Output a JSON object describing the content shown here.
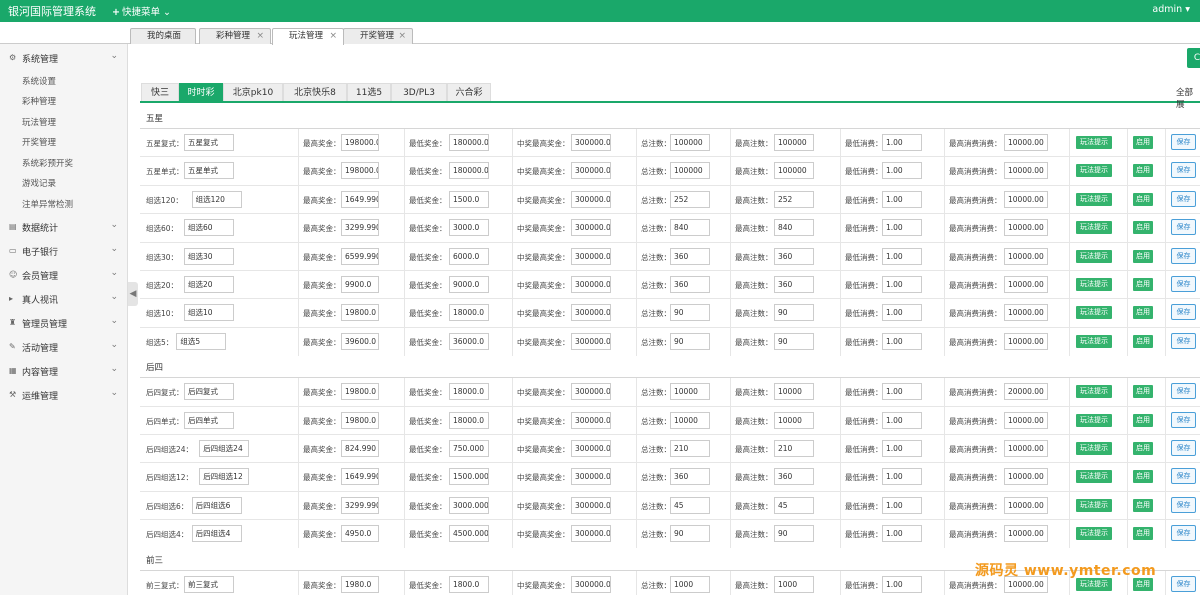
{
  "header": {
    "brand": "银河国际管理系统",
    "quick_menu": "快捷菜单",
    "user": "admin"
  },
  "tabs": [
    {
      "label": "我的桌面"
    },
    {
      "label": "彩种管理"
    },
    {
      "label": "玩法管理"
    },
    {
      "label": "开奖管理"
    }
  ],
  "sidebar": {
    "groups": [
      {
        "label": "系统管理",
        "icon": "gear-icon"
      },
      {
        "label": "数据统计",
        "icon": "chart-icon"
      },
      {
        "label": "电子银行",
        "icon": "bank-icon"
      },
      {
        "label": "会员管理",
        "icon": "user-icon"
      },
      {
        "label": "真人视讯",
        "icon": "video-icon"
      },
      {
        "label": "管理员管理",
        "icon": "admin-icon"
      },
      {
        "label": "活动管理",
        "icon": "event-icon"
      },
      {
        "label": "内容管理",
        "icon": "content-icon"
      },
      {
        "label": "运维管理",
        "icon": "ops-icon"
      }
    ],
    "sub_items": [
      "系统设置",
      "彩种管理",
      "玩法管理",
      "开奖管理",
      "系统彩预开奖",
      "游戏记录",
      "注单异常检测"
    ]
  },
  "lottery_tabs": [
    "快三",
    "时时彩",
    "北京pk10",
    "北京快乐8",
    "11选5",
    "3D/PL3",
    "六合彩"
  ],
  "all_label": "全部展",
  "field_labels": {
    "max_prize": "最高奖金：",
    "min_prize": "最低奖金：",
    "mid_prize": "中奖最高奖金：",
    "total_bets": "总注数：",
    "max_bets": "最高注数：",
    "min_spend": "最低消费：",
    "max_spend": "最高消费消费：",
    "tips_btn": "玩法提示",
    "enable_btn": "启用",
    "save_btn": "保存"
  },
  "sections": [
    {
      "title": "五星",
      "rows": [
        {
          "label": "五星复式：",
          "name": "五星复式",
          "max_prize": "198000.0",
          "min_prize": "180000.0",
          "mid_prize": "300000.0",
          "total": "100000",
          "max_bets": "100000",
          "min_spend": "1.00",
          "max_spend": "10000.00"
        },
        {
          "label": "五星单式：",
          "name": "五星单式",
          "max_prize": "198000.0",
          "min_prize": "180000.0",
          "mid_prize": "300000.0",
          "total": "100000",
          "max_bets": "100000",
          "min_spend": "1.00",
          "max_spend": "10000.00"
        },
        {
          "label": "组选120：",
          "name": "组选120",
          "max_prize": "1649.990",
          "min_prize": "1500.0",
          "mid_prize": "300000.0",
          "total": "252",
          "max_bets": "252",
          "min_spend": "1.00",
          "max_spend": "10000.00"
        },
        {
          "label": "组选60：",
          "name": "组选60",
          "max_prize": "3299.990",
          "min_prize": "3000.0",
          "mid_prize": "300000.0",
          "total": "840",
          "max_bets": "840",
          "min_spend": "1.00",
          "max_spend": "10000.00"
        },
        {
          "label": "组选30：",
          "name": "组选30",
          "max_prize": "6599.990",
          "min_prize": "6000.0",
          "mid_prize": "300000.0",
          "total": "360",
          "max_bets": "360",
          "min_spend": "1.00",
          "max_spend": "10000.00"
        },
        {
          "label": "组选20：",
          "name": "组选20",
          "max_prize": "9900.0",
          "min_prize": "9000.0",
          "mid_prize": "300000.0",
          "total": "360",
          "max_bets": "360",
          "min_spend": "1.00",
          "max_spend": "10000.00"
        },
        {
          "label": "组选10：",
          "name": "组选10",
          "max_prize": "19800.0",
          "min_prize": "18000.0",
          "mid_prize": "300000.0",
          "total": "90",
          "max_bets": "90",
          "min_spend": "1.00",
          "max_spend": "10000.00"
        },
        {
          "label": "组选5：",
          "name": "组选5",
          "max_prize": "39600.0",
          "min_prize": "36000.0",
          "mid_prize": "300000.0",
          "total": "90",
          "max_bets": "90",
          "min_spend": "1.00",
          "max_spend": "10000.00"
        }
      ]
    },
    {
      "title": "后四",
      "rows": [
        {
          "label": "后四复式：",
          "name": "后四复式",
          "max_prize": "19800.0",
          "min_prize": "18000.0",
          "mid_prize": "300000.0",
          "total": "10000",
          "max_bets": "10000",
          "min_spend": "1.00",
          "max_spend": "20000.00"
        },
        {
          "label": "后四单式：",
          "name": "后四单式",
          "max_prize": "19800.0",
          "min_prize": "18000.0",
          "mid_prize": "300000.0",
          "total": "10000",
          "max_bets": "10000",
          "min_spend": "1.00",
          "max_spend": "10000.00"
        },
        {
          "label": "后四组选24：",
          "name": "后四组选24",
          "max_prize": "824.990",
          "min_prize": "750.000",
          "mid_prize": "300000.0",
          "total": "210",
          "max_bets": "210",
          "min_spend": "1.00",
          "max_spend": "10000.00"
        },
        {
          "label": "后四组选12：",
          "name": "后四组选12",
          "max_prize": "1649.990",
          "min_prize": "1500.000",
          "mid_prize": "300000.0",
          "total": "360",
          "max_bets": "360",
          "min_spend": "1.00",
          "max_spend": "10000.00"
        },
        {
          "label": "后四组选6：",
          "name": "后四组选6",
          "max_prize": "3299.990",
          "min_prize": "3000.000",
          "mid_prize": "300000.0",
          "total": "45",
          "max_bets": "45",
          "min_spend": "1.00",
          "max_spend": "10000.00"
        },
        {
          "label": "后四组选4：",
          "name": "后四组选4",
          "max_prize": "4950.0",
          "min_prize": "4500.000",
          "mid_prize": "300000.0",
          "total": "90",
          "max_bets": "90",
          "min_spend": "1.00",
          "max_spend": "10000.00"
        }
      ]
    },
    {
      "title": "前三",
      "rows": [
        {
          "label": "前三复式：",
          "name": "前三复式",
          "max_prize": "1980.0",
          "min_prize": "1800.0",
          "mid_prize": "300000.0",
          "total": "1000",
          "max_bets": "1000",
          "min_spend": "1.00",
          "max_spend": "10000.00"
        }
      ]
    }
  ],
  "watermark": "源码灵 www.ymter.com",
  "colors": {
    "brand": "#1aa86a",
    "save": "#2b86c9"
  }
}
